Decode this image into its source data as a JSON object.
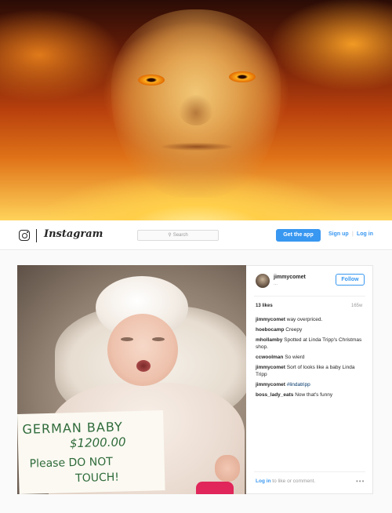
{
  "header": {
    "brand": "Instagram",
    "search_placeholder": "Search",
    "get_app": "Get the app",
    "sign_up": "Sign up",
    "separator": "|",
    "log_in": "Log in"
  },
  "sign": {
    "line1": "GERMAN BABY",
    "line2": "$1200.00",
    "line3": "Please DO NOT",
    "line4": "TOUCH!"
  },
  "post": {
    "username": "jimmycomet",
    "subtitle": "...",
    "follow": "Follow",
    "likes": "13 likes",
    "age": "165w",
    "comments": [
      {
        "user": "jimmycomet",
        "text": " way overpriced."
      },
      {
        "user": "hoebocamp",
        "text": " Creepy"
      },
      {
        "user": "mhollamby",
        "text": " Spotted at Linda Tripp's Christmas shop."
      },
      {
        "user": "ccwoolman",
        "text": " So wierd"
      },
      {
        "user": "jimmycomet",
        "text": " Sort of looks like a baby Linda Tripp"
      },
      {
        "user": "jimmycomet",
        "text": " #lindatripp"
      },
      {
        "user": "boss_lady_eats",
        "text": " Now that's funny"
      }
    ],
    "footer_login": "Log in",
    "footer_rest": " to like or comment.",
    "more": "•••"
  },
  "colors": {
    "accent": "#3897f0",
    "text": "#262626",
    "muted": "#999999",
    "sign_ink": "#2f6b3a"
  },
  "icons": {
    "logo": "instagram-camera-icon",
    "search": "search-icon",
    "more": "more-options-icon"
  }
}
